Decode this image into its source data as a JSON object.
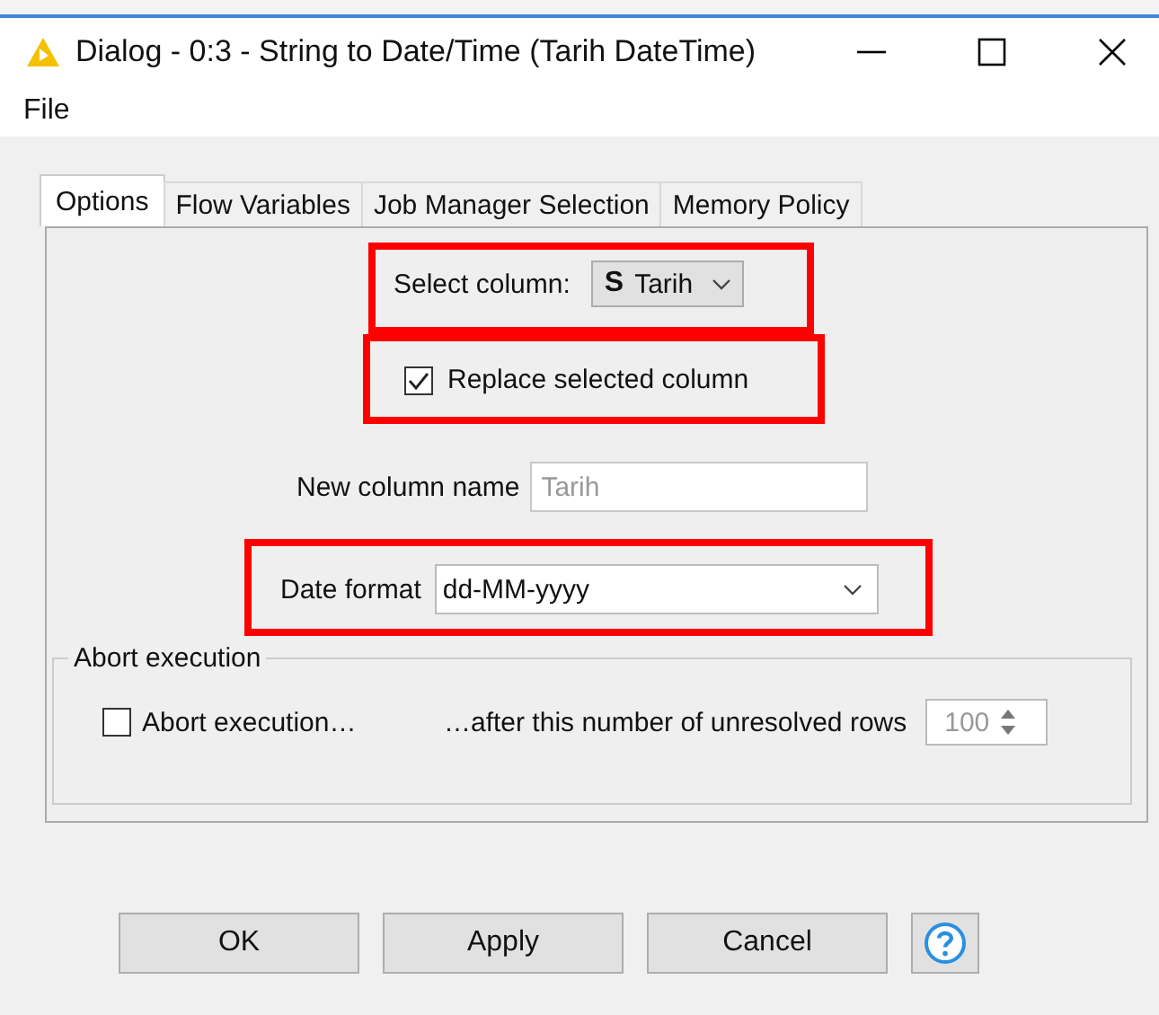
{
  "window": {
    "title": "Dialog - 0:3 - String to Date/Time (Tarih DateTime)"
  },
  "menu": [
    "File"
  ],
  "tabs": [
    {
      "label": "Options",
      "selected": true
    },
    {
      "label": "Flow Variables",
      "selected": false
    },
    {
      "label": "Job Manager Selection",
      "selected": false
    },
    {
      "label": "Memory Policy",
      "selected": false
    }
  ],
  "select_column": {
    "label": "Select column:",
    "type_badge": "S",
    "value": "Tarih",
    "highlighted": true
  },
  "replace_column": {
    "label": "Replace selected column",
    "checked": true,
    "highlighted": true
  },
  "new_column_name": {
    "label": "New column name",
    "value": "Tarih",
    "disabled": true
  },
  "date_format": {
    "label": "Date format",
    "value": "dd-MM-yyyy",
    "highlighted": true
  },
  "abort_group": {
    "title": "Abort execution",
    "checkbox": {
      "label": "Abort execution…",
      "checked": false
    },
    "rows_label": "…after this number of unresolved rows",
    "rows_value": "100",
    "rows_disabled": true
  },
  "buttons": [
    {
      "label": "OK"
    },
    {
      "label": "Apply"
    },
    {
      "label": "Cancel"
    }
  ]
}
